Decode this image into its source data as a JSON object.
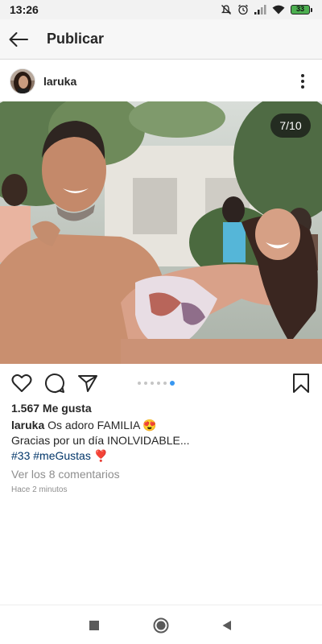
{
  "status_bar": {
    "time": "13:26",
    "battery": "33",
    "icons": [
      "mute-icon",
      "alarm-icon",
      "signal-icon",
      "wifi-icon",
      "battery-icon"
    ]
  },
  "header": {
    "title": "Publicar",
    "back_icon": "back-arrow-icon"
  },
  "post": {
    "username": "laruka",
    "more_icon": "more-options-icon",
    "image_counter": "7/10",
    "carousel": {
      "total": 10,
      "current": 7
    },
    "actions": [
      "heart-icon",
      "comment-icon",
      "share-icon",
      "bookmark-icon"
    ],
    "likes": "1.567 Me gusta",
    "caption": {
      "username": "laruka",
      "line1": "Os adoro FAMILIA 😍",
      "line2": "Gracias por un día INOLVIDABLE...",
      "hashtag1": "#33",
      "hashtag2": "#meGustas",
      "emoji": "❣️"
    },
    "view_comments": "Ver los 8 comentarios",
    "timestamp": "Hace 2 minutos"
  },
  "nav": [
    "recents-icon",
    "home-icon",
    "back-icon"
  ],
  "colors": {
    "accent": "#3897f0",
    "hashtag": "#003569",
    "secondary_text": "#8e8e8e",
    "battery_fill": "#4caf50"
  }
}
